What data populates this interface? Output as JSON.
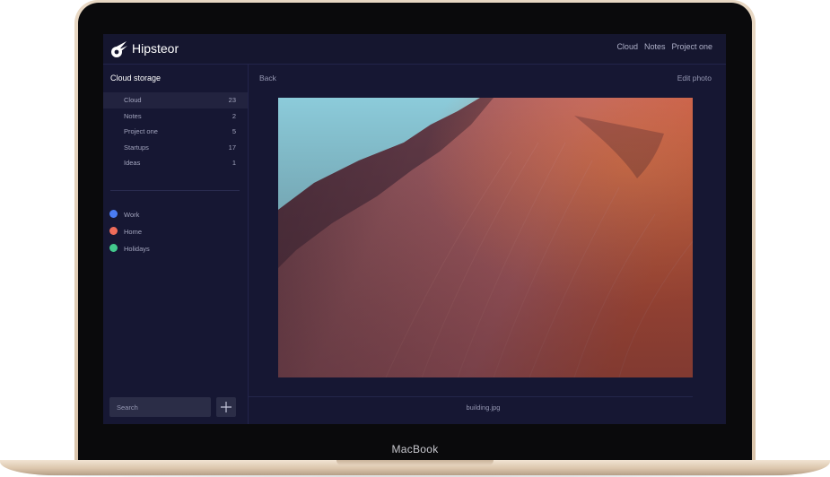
{
  "device": {
    "label": "MacBook"
  },
  "app": {
    "name": "Hipsteor",
    "top_nav": [
      "Cloud",
      "Notes",
      "Project one"
    ]
  },
  "sidebar": {
    "title": "Cloud storage",
    "folders": [
      {
        "label": "Cloud",
        "count": "23",
        "active": true
      },
      {
        "label": "Notes",
        "count": "2"
      },
      {
        "label": "Project one",
        "count": "5"
      },
      {
        "label": "Startups",
        "count": "17"
      },
      {
        "label": "Ideas",
        "count": "1"
      }
    ],
    "tags": [
      {
        "label": "Work",
        "color": "#4a7cf4"
      },
      {
        "label": "Home",
        "color": "#ef6c5a"
      },
      {
        "label": "Holidays",
        "color": "#43c98d"
      }
    ],
    "search_placeholder": "Search"
  },
  "main": {
    "back_label": "Back",
    "edit_label": "Edit photo",
    "file_name": "building.jpg"
  },
  "colors": {
    "screen_bg": "#161733",
    "accent_sky": "#8ccbda",
    "rock_dark": "#6e3f48",
    "rock_light": "#c0646a"
  }
}
